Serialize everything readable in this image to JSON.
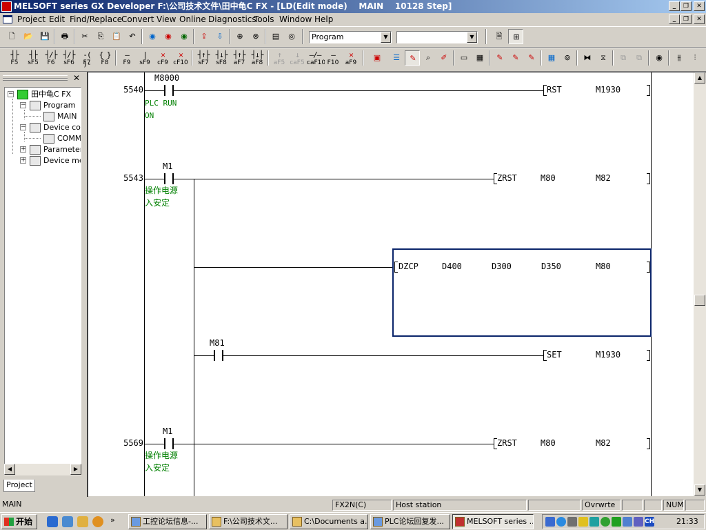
{
  "window": {
    "title": "MELSOFT series GX Developer F:\\公司技术文件\\田中龟C FX - [LD(Edit mode)    MAIN    10128 Step]"
  },
  "menu": [
    "Project",
    "Edit",
    "Find/Replace",
    "Convert",
    "View",
    "Online",
    "Diagnostics",
    "Tools",
    "Window",
    "Help"
  ],
  "toolbar": {
    "data_type_combo": "Program",
    "second_combo": ""
  },
  "ladder_keys": [
    {
      "sym": "┤├",
      "key": "F5"
    },
    {
      "sym": "┤├",
      "key": "sF5"
    },
    {
      "sym": "┤/├",
      "key": "F6"
    },
    {
      "sym": "┤/├",
      "key": "sF6"
    },
    {
      "sym": "-( )-",
      "key": "F7"
    },
    {
      "sym": "{ }",
      "key": "F8"
    },
    {
      "sym": "—",
      "key": "F9"
    },
    {
      "sym": "|",
      "key": "sF9"
    },
    {
      "sym": "✕",
      "key": "cF9"
    },
    {
      "sym": "✕",
      "key": "cF10"
    },
    {
      "sym": "┤↑├",
      "key": "sF7"
    },
    {
      "sym": "┤↓├",
      "key": "sF8"
    },
    {
      "sym": "┤↑├",
      "key": "aF7"
    },
    {
      "sym": "┤↓├",
      "key": "aF8"
    },
    {
      "sym": "↑",
      "key": "aF5"
    },
    {
      "sym": "↓",
      "key": "caF5"
    },
    {
      "sym": "—/—",
      "key": "caF10"
    },
    {
      "sym": "—",
      "key": "F10"
    },
    {
      "sym": "✕",
      "key": "aF9"
    }
  ],
  "project_tree": {
    "root": "田中龟C FX",
    "program": "Program",
    "main": "MAIN",
    "device_comment": "Device cor",
    "comment": "COMM",
    "parameter": "Parameter",
    "device_memory": "Device me",
    "tab": "Project"
  },
  "ladder": {
    "rung1": {
      "step": "5540",
      "device": "M8000",
      "comment1": "PLC RUN",
      "comment2": "ON",
      "instr": "RST",
      "op1": "M1930"
    },
    "rung2": {
      "step": "5543",
      "device": "M1",
      "comment1": "操作电源",
      "comment2": "入安定",
      "instr": "ZRST",
      "op1": "M80",
      "op2": "M82"
    },
    "rung2b": {
      "instr": "DZCP",
      "op1": "D400",
      "op2": "D300",
      "op3": "D350",
      "op4": "M80"
    },
    "rung2c": {
      "device": "M81",
      "instr": "SET",
      "op1": "M1930"
    },
    "rung3": {
      "step": "5569",
      "device": "M1",
      "comment1": "操作电源",
      "comment2": "入安定",
      "instr": "ZRST",
      "op1": "M80",
      "op2": "M82"
    }
  },
  "statusbar": {
    "program": "MAIN",
    "plc": "FX2N(C)",
    "station": "Host station",
    "mode": "Ovrwrte",
    "num": "NUM"
  },
  "taskbar": {
    "start": "开始",
    "tasks": [
      "工控论坛信息-...",
      "F:\\公司技术文...",
      "C:\\Documents a...",
      "PLC论坛回复发...",
      "MELSOFT series ..."
    ],
    "clock": "21:33",
    "ime": "CH"
  }
}
